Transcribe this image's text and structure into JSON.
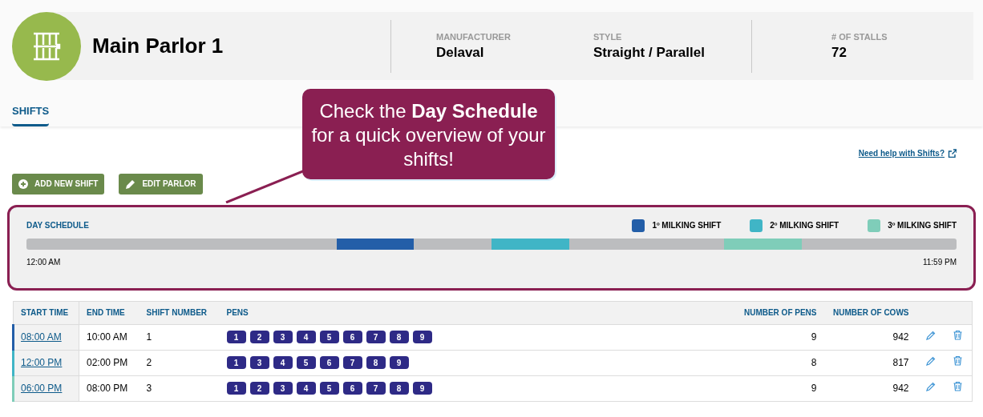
{
  "parlor": {
    "title": "Main Parlor 1",
    "details": [
      {
        "label": "MANUFACTURER",
        "value": "Delaval"
      },
      {
        "label": "STYLE",
        "value": "Straight / Parallel"
      },
      {
        "label": "# OF STALLS",
        "value": "72"
      }
    ]
  },
  "tabs": [
    {
      "label": "SHIFTS",
      "selected": true
    }
  ],
  "help_link": "Need help with Shifts?",
  "buttons": [
    {
      "kind": "add",
      "label": "ADD NEW SHIFT"
    },
    {
      "kind": "edit",
      "label": "EDIT PARLOR"
    }
  ],
  "callout": "Check the **Day Schedule** for a quick overview of your shifts!",
  "day_schedule": {
    "title": "DAY SCHEDULE",
    "legend": [
      {
        "label": "1º MILKING SHIFT",
        "color": "#235ea8"
      },
      {
        "label": "2º MILKING SHIFT",
        "color": "#40b5c6"
      },
      {
        "label": "3º MILKING SHIFT",
        "color": "#7fcdb9"
      }
    ],
    "start_label": "12:00 AM",
    "end_label": "11:59 PM"
  },
  "table": {
    "columns": [
      "START TIME",
      "END TIME",
      "SHIFT NUMBER",
      "PENS",
      "NUMBER OF PENS",
      "NUMBER OF COWS"
    ],
    "rows": [
      {
        "start": "08:00 AM",
        "end": "10:00 AM",
        "shift": "1",
        "pens": [
          "1",
          "2",
          "3",
          "4",
          "5",
          "6",
          "7",
          "8",
          "9"
        ],
        "num_pens": "9",
        "num_cows": "942"
      },
      {
        "start": "12:00 PM",
        "end": "02:00 PM",
        "shift": "2",
        "pens": [
          "1",
          "3",
          "4",
          "5",
          "6",
          "7",
          "8",
          "9"
        ],
        "num_pens": "8",
        "num_cows": "817"
      },
      {
        "start": "06:00 PM",
        "end": "08:00 PM",
        "shift": "3",
        "pens": [
          "1",
          "2",
          "3",
          "4",
          "5",
          "6",
          "7",
          "8",
          "9"
        ],
        "num_pens": "9",
        "num_cows": "942"
      }
    ]
  }
}
